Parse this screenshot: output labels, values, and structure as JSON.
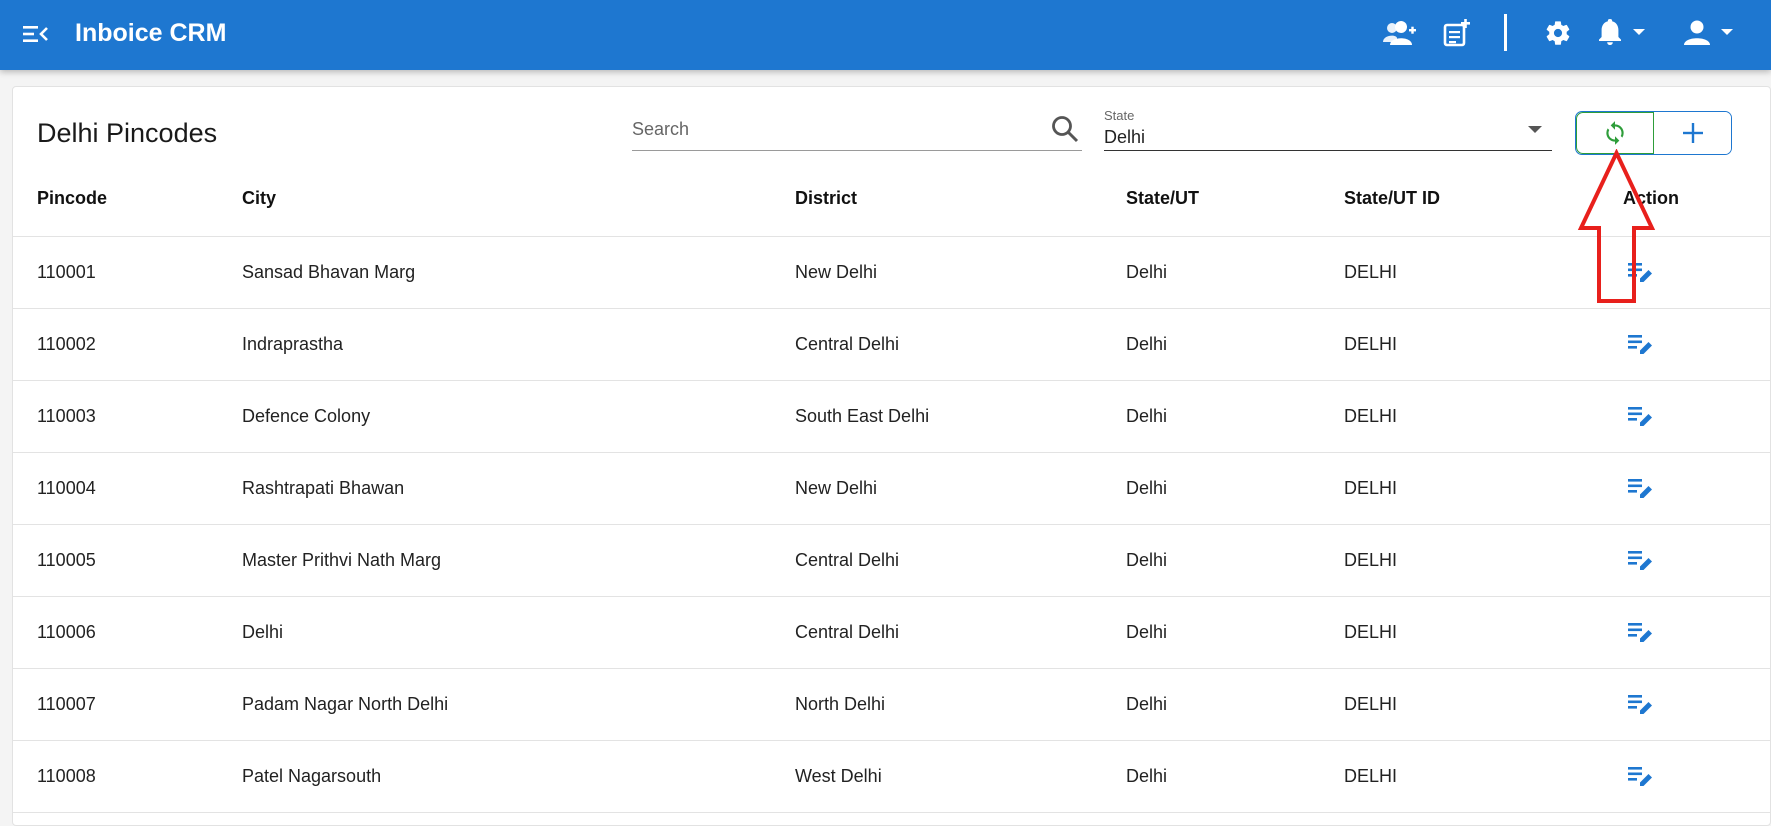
{
  "app": {
    "title": "Inboice CRM"
  },
  "header_icons": [
    "menu-collapse-icon",
    "add-user-icon",
    "add-note-icon",
    "gear-icon",
    "bell-icon",
    "user-icon"
  ],
  "colors": {
    "appbar": "#1e77d0",
    "accent": "#1e77d0",
    "sync": "#2e9d3a",
    "annotation": "#e8201c"
  },
  "page": {
    "title": "Delhi Pincodes",
    "search": {
      "placeholder": "Search",
      "value": ""
    },
    "state_filter": {
      "label": "State",
      "value": "Delhi"
    }
  },
  "table": {
    "headers": [
      "Pincode",
      "City",
      "District",
      "State/UT",
      "State/UT ID",
      "Action"
    ],
    "rows": [
      [
        "110001",
        "Sansad Bhavan Marg",
        "New Delhi",
        "Delhi",
        "DELHI"
      ],
      [
        "110002",
        "Indraprastha",
        "Central Delhi",
        "Delhi",
        "DELHI"
      ],
      [
        "110003",
        "Defence Colony",
        "South East Delhi",
        "Delhi",
        "DELHI"
      ],
      [
        "110004",
        "Rashtrapati Bhawan",
        "New Delhi",
        "Delhi",
        "DELHI"
      ],
      [
        "110005",
        "Master Prithvi Nath Marg",
        "Central Delhi",
        "Delhi",
        "DELHI"
      ],
      [
        "110006",
        "Delhi",
        "Central Delhi",
        "Delhi",
        "DELHI"
      ],
      [
        "110007",
        "Padam Nagar North Delhi",
        "North Delhi",
        "Delhi",
        "DELHI"
      ],
      [
        "110008",
        "Patel Nagarsouth",
        "West Delhi",
        "Delhi",
        "DELHI"
      ]
    ]
  }
}
